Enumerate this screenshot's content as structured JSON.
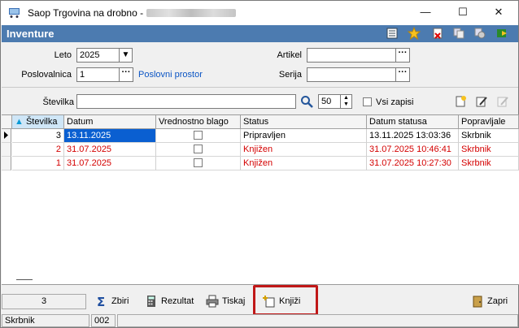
{
  "window": {
    "title": "Saop Trgovina na drobno -",
    "minimize": "—",
    "maximize": "☐",
    "close": "✕"
  },
  "header": {
    "title": "Inventure"
  },
  "form": {
    "leto_label": "Leto",
    "leto_value": "2025",
    "poslovalnica_label": "Poslovalnica",
    "poslovalnica_value": "1",
    "poslovni_prostor_link": "Poslovni prostor",
    "artikel_label": "Artikel",
    "artikel_value": "",
    "serija_label": "Serija",
    "serija_value": "",
    "stevilka_label": "Številka",
    "stevilka_value": "",
    "page_size": "50",
    "vsi_zapisi_label": "Vsi zapisi"
  },
  "grid": {
    "columns": [
      "Številka",
      "Datum",
      "Vrednostno blago",
      "Status",
      "Datum statusa",
      "Popravljale"
    ],
    "rows": [
      {
        "stevilka": "3",
        "datum": "13.11.2025",
        "status": "Pripravljen",
        "datum_statusa": "13.11.2025 13:03:36",
        "popravljal": "Skrbnik",
        "red": false,
        "selected": true
      },
      {
        "stevilka": "2",
        "datum": "31.07.2025",
        "status": "Knjižen",
        "datum_statusa": "31.07.2025 10:46:41",
        "popravljal": "Skrbnik",
        "red": true,
        "selected": false
      },
      {
        "stevilka": "1",
        "datum": "31.07.2025",
        "status": "Knjižen",
        "datum_statusa": "31.07.2025 10:27:30",
        "popravljal": "Skrbnik",
        "red": true,
        "selected": false
      }
    ]
  },
  "footer": {
    "count": "3",
    "zbiri": "Zbiri",
    "rezultat": "Rezultat",
    "tiskaj": "Tiskaj",
    "knjizi": "Knjiži",
    "zapri": "Zapri",
    "user": "Skrbnik",
    "code": "002"
  },
  "colors": {
    "header_band": "#4c7bb0",
    "selection": "#0a5fd1",
    "posted_text": "#d40000",
    "highlight": "#c01818"
  }
}
